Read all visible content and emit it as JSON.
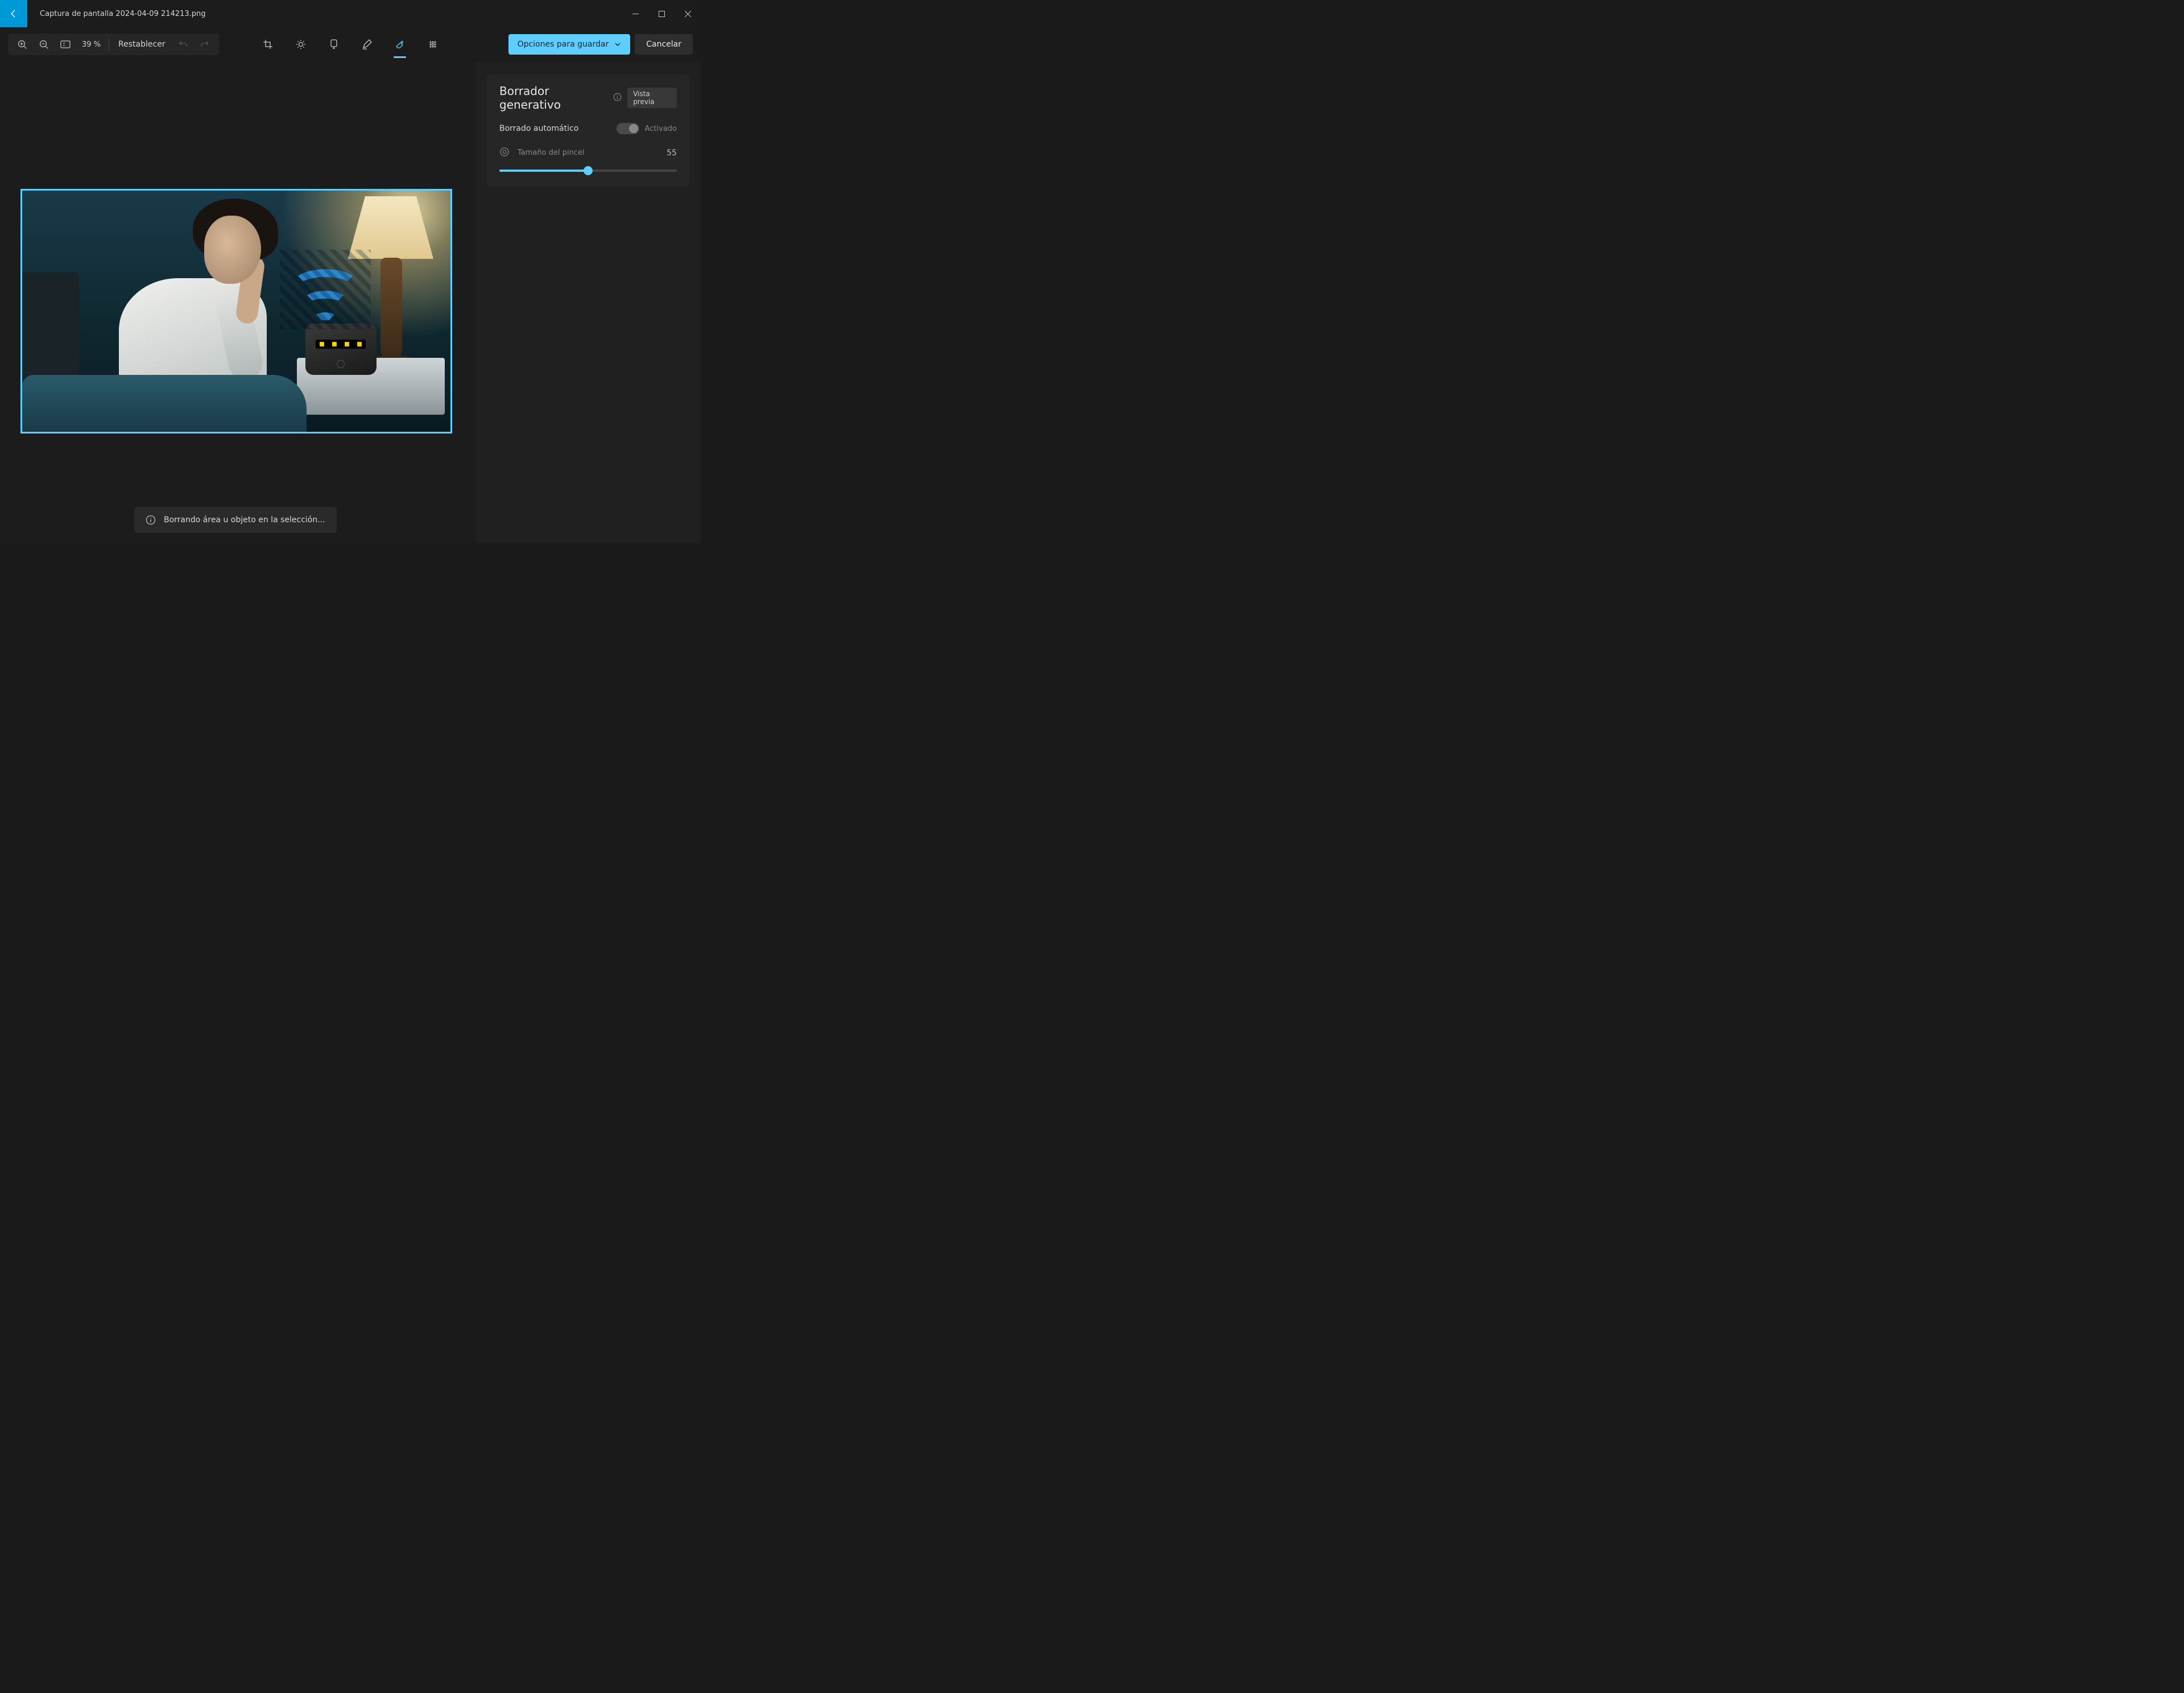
{
  "titlebar": {
    "filename": "Captura de pantalla 2024-04-09 214213.png"
  },
  "toolbar": {
    "zoom": "39 %",
    "reset": "Restablecer",
    "save": "Opciones para guardar",
    "cancel": "Cancelar"
  },
  "panel": {
    "title": "Borrador generativo",
    "badge": "Vista previa",
    "auto_erase_label": "Borrado automático",
    "auto_erase_state": "Activado",
    "brush_label": "Tamaño del pincel",
    "brush_value": "55",
    "brush_min": 1,
    "brush_max": 100
  },
  "toast": {
    "message": "Borrando área u objeto en la selección..."
  }
}
